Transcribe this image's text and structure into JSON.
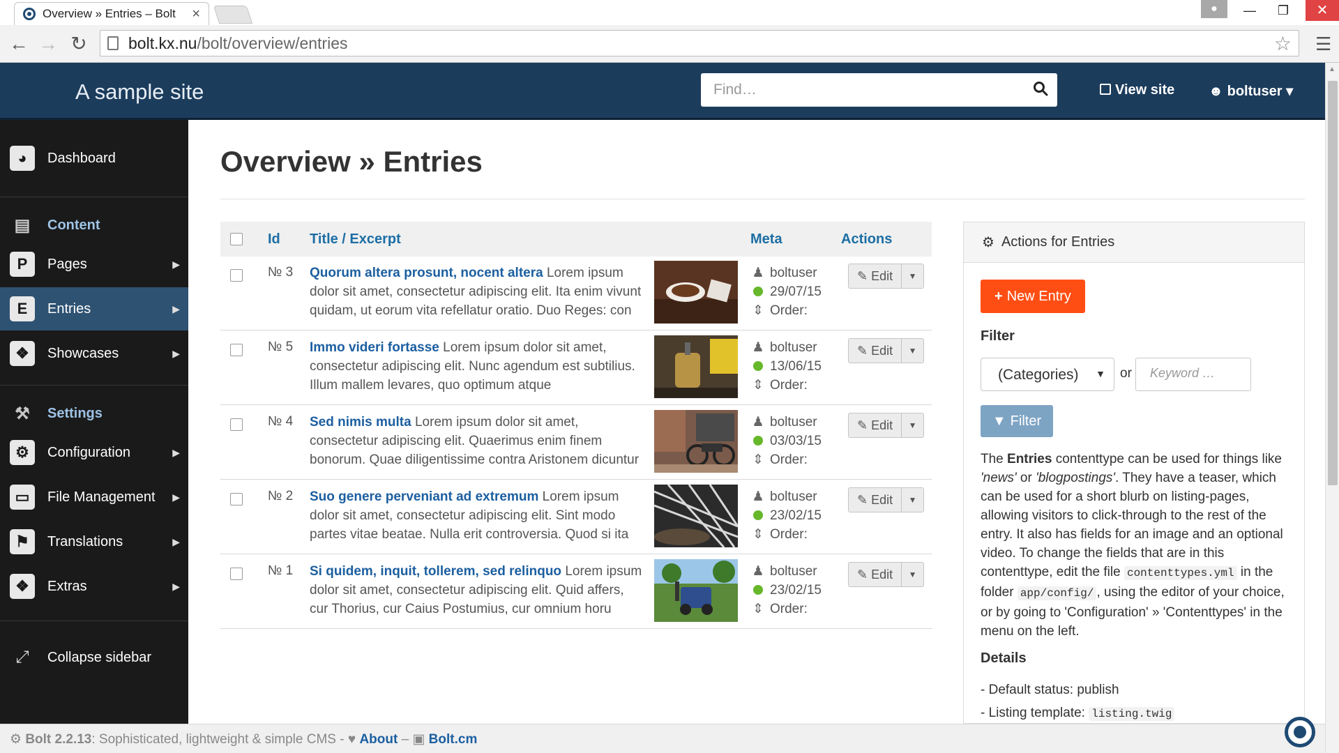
{
  "browser": {
    "tab_title": "Overview » Entries – Bolt",
    "url_host": "bolt.kx.nu",
    "url_path": "/bolt/overview/entries"
  },
  "header": {
    "site_name": "A sample site",
    "search_placeholder": "Find…",
    "view_site": "View site",
    "user": "boltuser"
  },
  "sidebar": {
    "dashboard": "Dashboard",
    "content_section": "Content",
    "items_content": [
      {
        "icon": "P",
        "label": "Pages"
      },
      {
        "icon": "E",
        "label": "Entries"
      },
      {
        "icon": "showcases-icon",
        "label": "Showcases"
      }
    ],
    "settings_section": "Settings",
    "items_settings": [
      {
        "icon": "configuration-icon",
        "label": "Configuration"
      },
      {
        "icon": "folder-icon",
        "label": "File Management"
      },
      {
        "icon": "flag-icon",
        "label": "Translations"
      },
      {
        "icon": "extras-icon",
        "label": "Extras"
      }
    ],
    "collapse": "Collapse sidebar"
  },
  "page": {
    "title_bold": "Overview",
    "title_rest": " » Entries"
  },
  "table": {
    "headers": {
      "id": "Id",
      "title": "Title / Excerpt",
      "meta": "Meta",
      "actions": "Actions"
    },
    "edit_label": "Edit",
    "order_label": "Order:",
    "rows": [
      {
        "id": "№ 3",
        "title": "Quorum altera prosunt, nocent altera",
        "excerpt": " Lorem ipsum dolor sit amet, consectetur adipiscing elit. Ita enim vivunt quidam, ut eorum vita refellatur oratio. Duo Reges: con",
        "author": "boltuser",
        "date": "29/07/15"
      },
      {
        "id": "№ 5",
        "title": "Immo videri fortasse",
        "excerpt": " Lorem ipsum dolor sit amet, consectetur adipiscing elit. Nunc agendum est subtilius. Illum mallem levares, quo optimum atque humanissimum",
        "author": "boltuser",
        "date": "13/06/15"
      },
      {
        "id": "№ 4",
        "title": "Sed nimis multa",
        "excerpt": " Lorem ipsum dolor sit amet, consectetur adipiscing elit. Quaerimus enim finem bonorum. Quae diligentissime contra Aristonem dicuntur a Chryippo.",
        "author": "boltuser",
        "date": "03/03/15"
      },
      {
        "id": "№ 2",
        "title": "Suo genere perveniant ad extremum",
        "excerpt": " Lorem ipsum dolor sit amet, consectetur adipiscing elit. Sint modo partes vitae beatae. Nulla erit controversia. Quod si ita sit,",
        "author": "boltuser",
        "date": "23/02/15"
      },
      {
        "id": "№ 1",
        "title": "Si quidem, inquit, tollerem, sed relinquo",
        "excerpt": " Lorem ipsum dolor sit amet, consectetur adipiscing elit. Quid affers, cur Thorius, cur Caius Postumius, cur omnium horu",
        "author": "boltuser",
        "date": "23/02/15"
      }
    ]
  },
  "panel": {
    "title": "Actions for Entries",
    "new_entry": "New Entry",
    "filter_label": "Filter",
    "categories": "(Categories)",
    "or": "or",
    "keyword_placeholder": "Keyword …",
    "filter_button": "Filter",
    "desc_1": "The ",
    "desc_bold": "Entries",
    "desc_2": " contenttype can be used for things like ",
    "desc_news": "'news'",
    "desc_3": " or ",
    "desc_blog": "'blogpostings'",
    "desc_4": ". They have a teaser, which can be used for a short blurb on listing-pages, allowing visitors to click-through to the rest of the entry. It also has fields for an image and an optional video. To change the fields that are in this contenttype, edit the file ",
    "desc_code1": "contenttypes.yml",
    "desc_5": " in the folder ",
    "desc_code2": "app/config/",
    "desc_6": ", using the editor of your choice, or by going to 'Configuration' » 'Contenttypes' in the menu on the left.",
    "details_label": "Details",
    "default_status": "- Default status: publish",
    "listing_template_label": "- Listing template: ",
    "listing_template": "listing.twig"
  },
  "footer": {
    "version": "Bolt 2.2.13",
    "tagline": ": Sophisticated, lightweight & simple CMS - ",
    "about": "About",
    "sep": " – ",
    "boltcm": "Bolt.cm"
  },
  "colors": {
    "header": "#1c3c5c",
    "sidebar": "#1a1a1a",
    "accent": "#ff4e14",
    "link": "#1c5fa0"
  }
}
